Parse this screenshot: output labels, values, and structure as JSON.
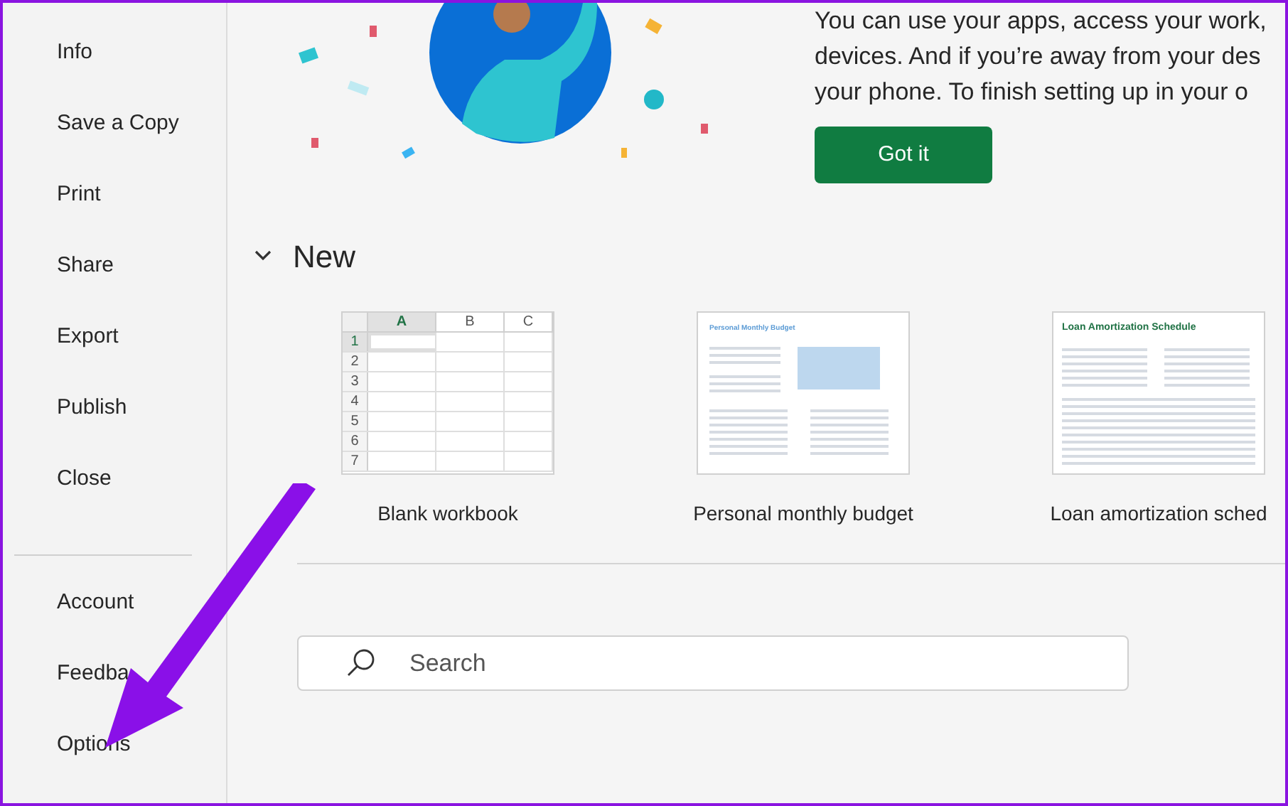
{
  "sidebar": {
    "items": [
      {
        "label": "Info"
      },
      {
        "label": "Save a Copy"
      },
      {
        "label": "Print"
      },
      {
        "label": "Share"
      },
      {
        "label": "Export"
      },
      {
        "label": "Publish"
      },
      {
        "label": "Close"
      }
    ],
    "bottom_items": [
      {
        "label": "Account"
      },
      {
        "label": "Feedba"
      },
      {
        "label": "Options"
      }
    ]
  },
  "banner": {
    "lines": [
      "You can use your apps, access your work,",
      "devices. And if you’re away from your des",
      "your phone. To finish setting up in your o"
    ],
    "button": "Got it"
  },
  "new_section": {
    "title": "New",
    "expanded": true,
    "templates": [
      {
        "kind": "blank",
        "label": "Blank workbook",
        "columns": [
          "A",
          "B",
          "C"
        ],
        "rows": [
          "1",
          "2",
          "3",
          "4",
          "5",
          "6",
          "7"
        ]
      },
      {
        "kind": "budget",
        "label": "Personal monthly budget",
        "heading": "Personal Monthly Budget"
      },
      {
        "kind": "loan",
        "label": "Loan amortization sched",
        "heading": "Loan Amortization Schedule"
      }
    ]
  },
  "search": {
    "placeholder": "Search"
  }
}
